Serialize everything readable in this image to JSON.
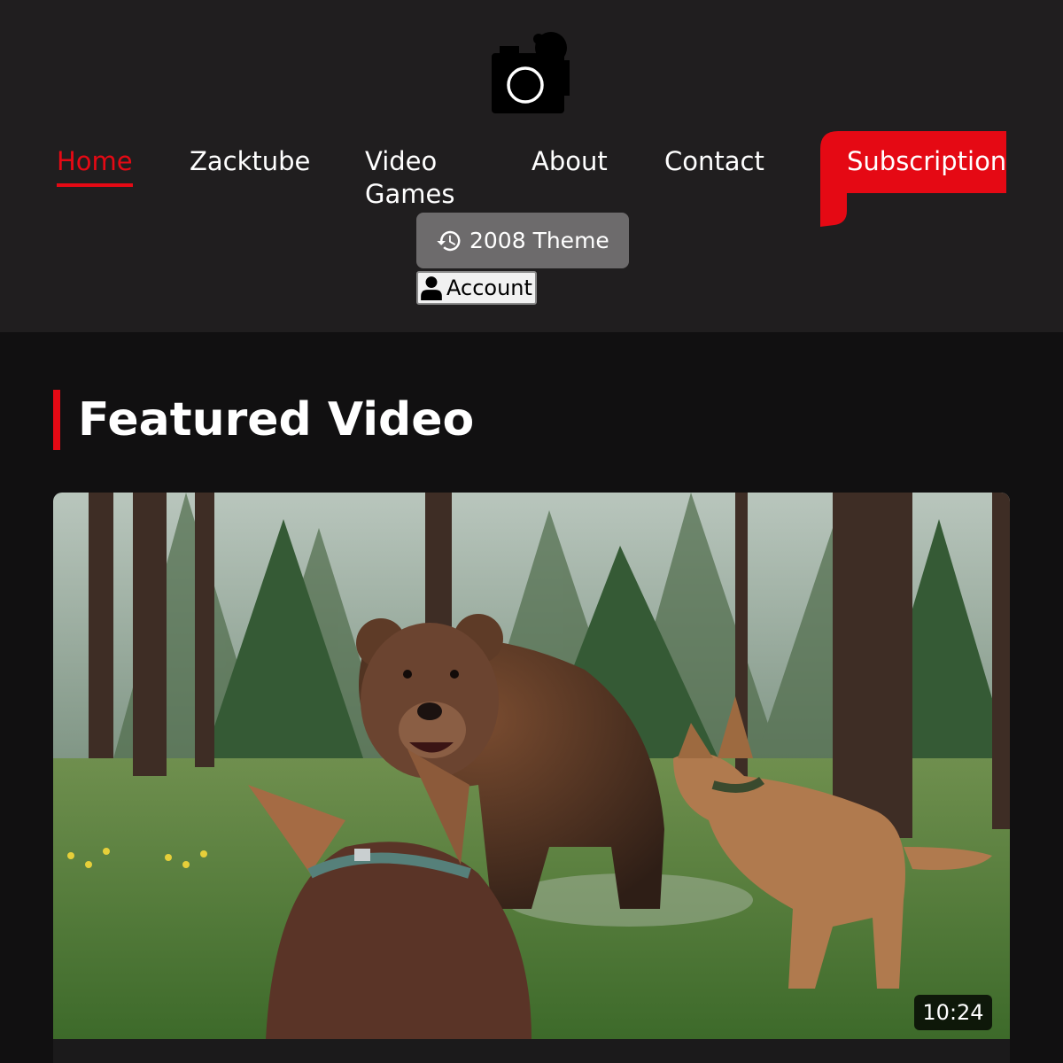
{
  "header": {
    "logo_icon": "camera-icon",
    "nav": [
      {
        "label": "Home",
        "active": true
      },
      {
        "label": "Zacktube",
        "active": false
      },
      {
        "label": "Video",
        "label2": "Games",
        "active": false
      },
      {
        "label": "About",
        "active": false
      },
      {
        "label": "Contact",
        "active": false
      }
    ],
    "subscribe_label": "Subscription",
    "theme_button": {
      "label": "2008 Theme",
      "icon": "history-icon"
    },
    "account_button": {
      "label": "Account",
      "icon": "user-icon"
    }
  },
  "main": {
    "section_title": "Featured Video",
    "featured_video": {
      "duration": "10:24"
    }
  },
  "colors": {
    "accent": "#e50914",
    "header_bg": "#201e1f",
    "page_bg": "#111011"
  }
}
